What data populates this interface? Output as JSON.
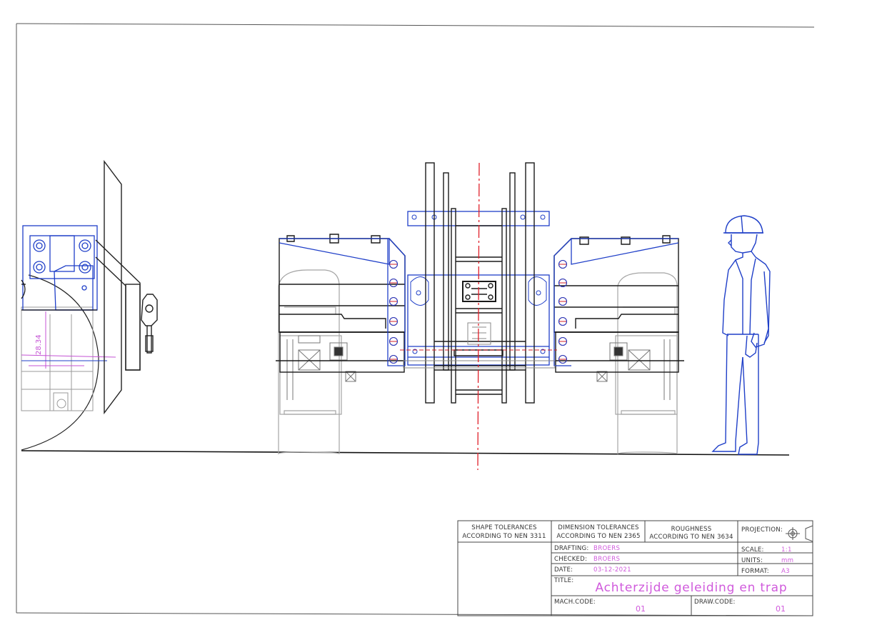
{
  "titleblock": {
    "shape_tol_1": "SHAPE TOLERANCES",
    "shape_tol_2": "ACCORDING TO NEN 3311",
    "dim_tol_1": "DIMENSION TOLERANCES",
    "dim_tol_2": "ACCORDING TO NEN 2365",
    "rough_1": "ROUGHNESS",
    "rough_2": "ACCORDING TO NEN 3634",
    "projection_label": "PROJECTION:",
    "drafting_label": "DRAFTING:",
    "drafting_value": "BROERS",
    "checked_label": "CHECKED:",
    "checked_value": "BROERS",
    "date_label": "DATE:",
    "date_value": "03-12-2021",
    "title_label": "TITLE:",
    "title_value": "Achterzijde geleiding en trap",
    "scale_label": "SCALE:",
    "scale_value": "1:1",
    "units_label": "UNITS:",
    "units_value": "mm",
    "format_label": "FORMAT:",
    "format_value": "A3",
    "mach_code_label": "MACH.CODE:",
    "mach_code_value": "01",
    "draw_code_label": "DRAW.CODE:",
    "draw_code_value": "01"
  },
  "drawing": {
    "dimension_label": "28.34"
  },
  "colors": {
    "line_black": "#1a1a1a",
    "line_blue": "#1f3fc8",
    "line_grey": "#8a8a8a",
    "centerline_red": "#e0202a",
    "annotation_magenta": "#d05adc"
  },
  "icons": {
    "projection_symbol": "first-angle-projection-icon"
  }
}
